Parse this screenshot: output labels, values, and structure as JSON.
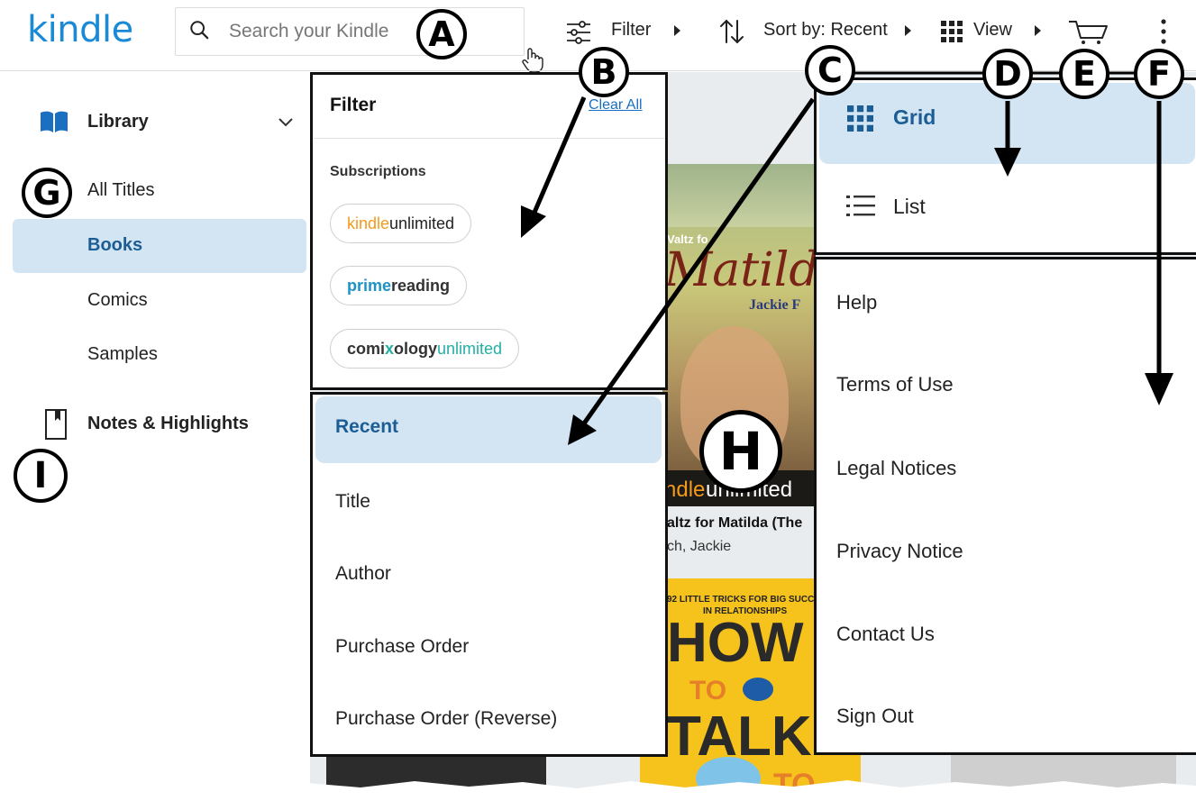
{
  "header": {
    "logo": "kindle",
    "search_placeholder": "Search your Kindle",
    "filter_label": "Filter",
    "sort_label": "Sort by: Recent",
    "view_label": "View"
  },
  "sidebar": {
    "library_label": "Library",
    "items": [
      "All Titles",
      "Books",
      "Comics",
      "Samples"
    ],
    "notes_label": "Notes & Highlights"
  },
  "filter_panel": {
    "title": "Filter",
    "clear_all": "Clear All",
    "section": "Subscriptions",
    "kindle_pill": {
      "part1": "kindle",
      "part2": "unlimited"
    },
    "prime_pill": {
      "part1": "prime",
      "part2": " reading"
    },
    "comix_pill": {
      "part1": "comi",
      "part2": "x",
      "part3": "ology",
      "part4": "unlimited"
    }
  },
  "sort_panel": {
    "options": [
      "Recent",
      "Title",
      "Author",
      "Purchase Order",
      "Purchase Order (Reverse)"
    ],
    "selected": "Recent"
  },
  "view_panel": {
    "options": [
      "Grid",
      "List"
    ],
    "selected": "Grid"
  },
  "more_menu": {
    "items": [
      "Help",
      "Terms of Use",
      "Legal Notices",
      "Privacy Notice",
      "Contact Us",
      "Sign Out"
    ]
  },
  "books": {
    "matilda_cover_top": "Valtz fo",
    "matilda_cover_title": "Matilda",
    "matilda_cover_author": "Jackie F",
    "matilda_badge_a": "ndle",
    "matilda_badge_b": "unlimited",
    "matilda_title": "altz for Matilda (The",
    "matilda_author": "ch, Jackie",
    "how_top_line1": "92 LITTLE TRICKS FOR BIG SUCC",
    "how_top_line2": "IN RELATIONSHIPS",
    "how_word1": "HOW",
    "how_word2": "TO",
    "how_word3": "TALK",
    "how_word4": "TO"
  },
  "callouts": [
    "A",
    "B",
    "C",
    "D",
    "E",
    "F",
    "G",
    "H",
    "I"
  ],
  "icons": {
    "search": "search-icon",
    "filter": "sliders-icon",
    "sort": "sort-arrows-icon",
    "view": "grid-icon",
    "cart": "cart-icon",
    "more": "more-vertical-icon",
    "library": "open-book-icon",
    "notes": "notebook-icon",
    "chevron": "chevron-down-icon",
    "list": "list-icon"
  },
  "colors": {
    "brand_blue": "#1a8ad6",
    "selected_bg": "#d3e4f2",
    "selected_text": "#1b5d94",
    "kindle_orange": "#f39a1c",
    "prime_blue": "#1d93c6",
    "comixology_teal": "#22b0a3"
  }
}
